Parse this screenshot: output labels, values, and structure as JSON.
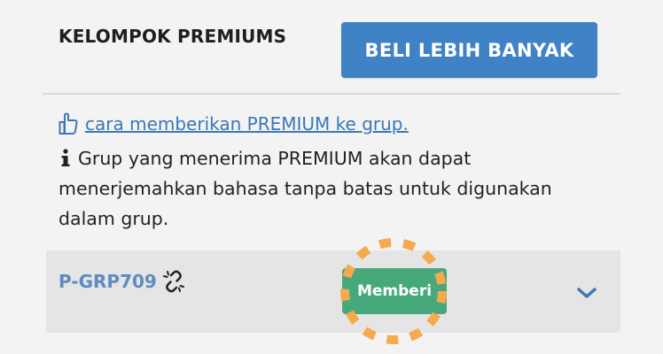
{
  "header": {
    "title": "KELOMPOK PREMIUMS",
    "buy_button": "BELI LEBIH BANYAK"
  },
  "help": {
    "link_text": "cara memberikan PREMIUM ke grup.",
    "icon": "thumbs-up-pointing-icon"
  },
  "info": {
    "icon": "info-icon",
    "text": "Grup yang menerima PREMIUM akan dapat menerjemahkan bahasa tanpa batas untuk digunakan dalam grup."
  },
  "group": {
    "name": "P-GRP709",
    "link_icon": "broken-link-icon",
    "give_button": "Memberi",
    "expand_icon": "chevron-down-icon"
  },
  "colors": {
    "accent_blue": "#3f82c6",
    "link_blue": "#3b78b6",
    "give_green": "#47a87c",
    "highlight_orange": "#f7a94e"
  }
}
